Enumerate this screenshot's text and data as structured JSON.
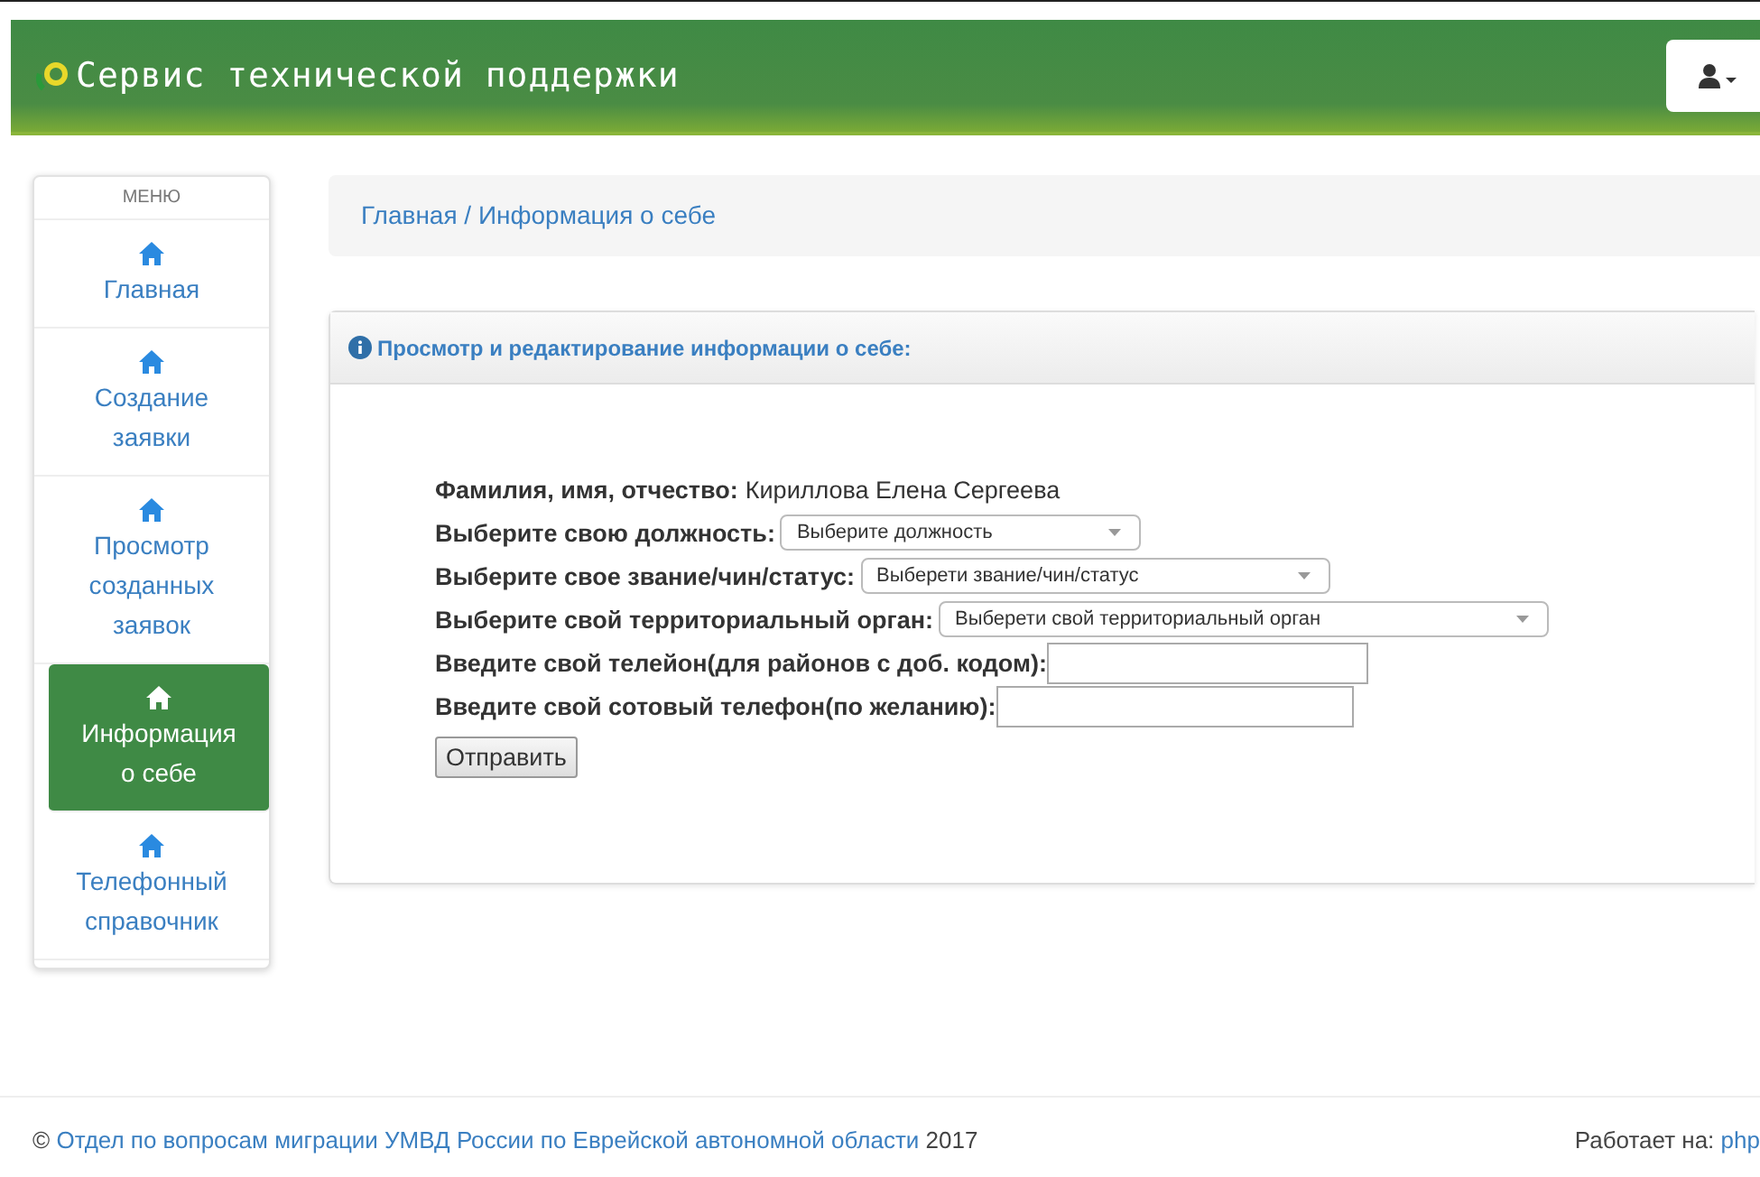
{
  "header": {
    "title": "Сервис технической поддержки"
  },
  "menu": {
    "heading": "МЕНЮ",
    "items": [
      {
        "label": "Главная",
        "selected": false
      },
      {
        "label": "Создание заявки",
        "selected": false
      },
      {
        "label": "Просмотр созданных заявок",
        "selected": false
      },
      {
        "label": "Информация о себе",
        "selected": true
      },
      {
        "label": "Телефонный справочник",
        "selected": false
      }
    ]
  },
  "breadcrumb": "Главная / Информация о себе",
  "panel": {
    "title": "Просмотр и редактирование информации о себе:",
    "rows": [
      {
        "kind": "text",
        "label": "Фамилия, имя, отчество:",
        "value": "Кириллова Елена Сергеева"
      },
      {
        "kind": "select",
        "label": "Выберите свою должность:",
        "value": "Выберите должность"
      },
      {
        "kind": "select",
        "label": "Выберите свое звание/чин/статус:",
        "value": "Выберети звание/чин/статус"
      },
      {
        "kind": "select",
        "label": "Выберите свой территориальный орган:",
        "value": "Выберети свой территориальный орган"
      },
      {
        "kind": "input",
        "label": "Введите свой телейон(для районов с доб. кодом):"
      },
      {
        "kind": "input",
        "label": "Введите свой сотовый телефон(по желанию):"
      },
      {
        "kind": "button",
        "label": "Отправить"
      }
    ]
  },
  "footer": {
    "copyright": "©",
    "link": "Отдел по вопросам миграции УМВД России по Еврейской автономной области",
    "year": "2017",
    "powered_label": "Работает на:",
    "powered_link": "php"
  }
}
